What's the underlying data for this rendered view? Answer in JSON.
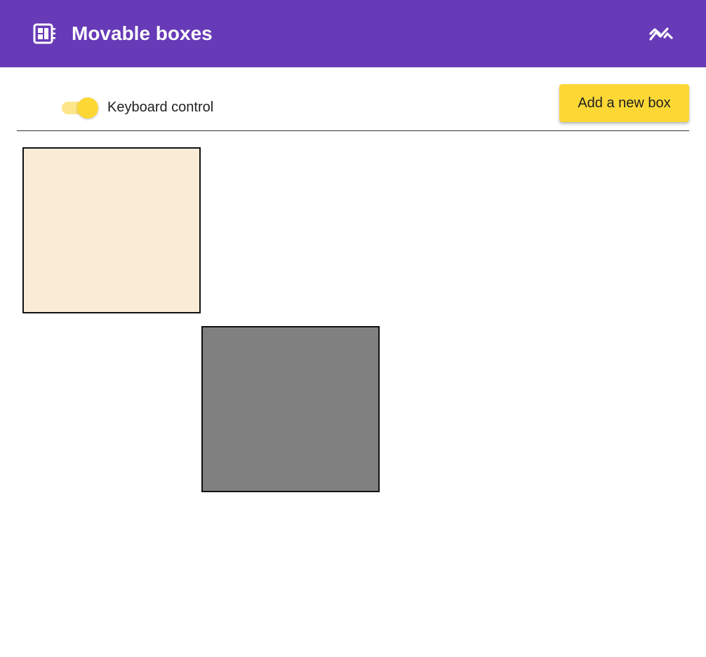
{
  "app_bar": {
    "title": "Movable boxes",
    "logo_icon": "dashboard-module-icon",
    "action_icon": "trending-icon",
    "background_color": "#673ab7"
  },
  "toolbar": {
    "keyboard_toggle": {
      "label": "Keyboard control",
      "checked": true,
      "accent_color": "#fdd835"
    },
    "add_button_label": "Add a new box",
    "add_button_color": "#fdd835"
  },
  "boxes": [
    {
      "color": "#faebd7",
      "selected": false
    },
    {
      "color": "#808080",
      "selected": true
    }
  ]
}
